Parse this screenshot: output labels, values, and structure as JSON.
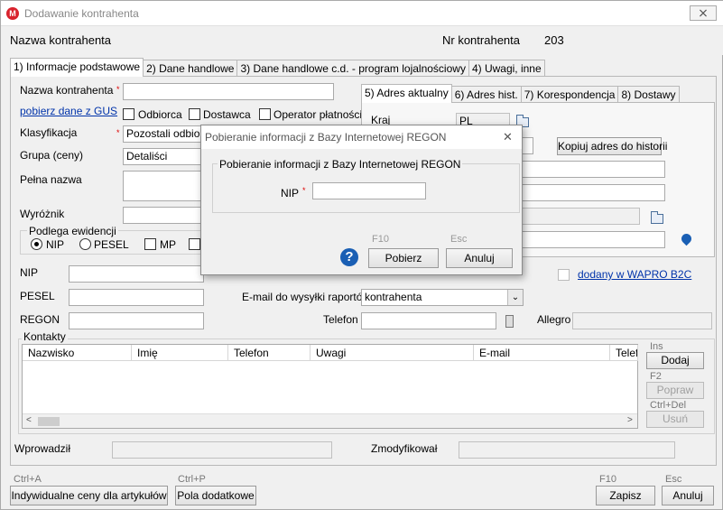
{
  "window": {
    "title": "Dodawanie kontrahenta",
    "close": "⨯"
  },
  "header": {
    "name_label": "Nazwa kontrahenta",
    "nr_label": "Nr kontrahenta",
    "nr_value": "203"
  },
  "tabs": [
    {
      "label": "1) Informacje podstawowe"
    },
    {
      "label": "2) Dane handlowe"
    },
    {
      "label": "3) Dane handlowe c.d. - program lojalnościowy"
    },
    {
      "label": "4) Uwagi, inne"
    }
  ],
  "form": {
    "nazwa_label": "Nazwa kontrahenta",
    "nazwa_value": "",
    "gus_link": "pobierz dane z GUS",
    "odbiorca": "Odbiorca",
    "dostawca": "Dostawca",
    "operator": "Operator płatności",
    "klasyfikacja_label": "Klasyfikacja",
    "klasyfikacja_value": "Pozostali odbiorcy",
    "grupa_label": "Grupa (ceny)",
    "grupa_value": "Detaliści",
    "pelna_label": "Pełna nazwa",
    "wyroznik_label": "Wyróżnik",
    "ewidencja_label": "Podlega ewidencji",
    "radio_nip": "NIP",
    "radio_pesel": "PESEL",
    "chk_mp": "MP",
    "nip_label": "NIP",
    "pesel_label": "PESEL",
    "regon_label": "REGON",
    "email_raport_label": "E-mail do wysyłki raportów",
    "email_raport_value": "kontrahenta",
    "telefon_label": "Telefon",
    "allegro_label": "Allegro",
    "wapro_link": "dodany w WAPRO B2C",
    "kontakty_label": "Kontakty",
    "wprowadzil_label": "Wprowadził",
    "zmodyfikowal_label": "Zmodyfikował"
  },
  "address_tabs": [
    {
      "label": "5) Adres aktualny"
    },
    {
      "label": "6) Adres hist."
    },
    {
      "label": "7) Korespondencja"
    },
    {
      "label": "8) Dostawy"
    }
  ],
  "address": {
    "kraj_label": "Kraj",
    "kraj_value": "PL",
    "kopiuj_button": "Kopiuj adres do historii"
  },
  "kontakty": {
    "columns": [
      "Nazwisko",
      "Imię",
      "Telefon",
      "Uwagi",
      "E-mail",
      "Telef"
    ],
    "hint_ins": "Ins",
    "btn_dodaj": "Dodaj",
    "hint_f2": "F2",
    "btn_popraw": "Popraw",
    "hint_ctrldel": "Ctrl+Del",
    "btn_usun": "Usuń"
  },
  "footer": {
    "hint_ctrla": "Ctrl+A",
    "btn_ceny": "Indywidualne ceny dla artykułów",
    "hint_ctrlp": "Ctrl+P",
    "btn_pola": "Pola dodatkowe",
    "hint_f10": "F10",
    "btn_zapisz": "Zapisz",
    "hint_esc": "Esc",
    "btn_anuluj": "Anuluj"
  },
  "dialog": {
    "title": "Pobieranie informacji z Bazy Internetowej REGON",
    "close": "✕",
    "group_label": "Pobieranie informacji z Bazy Internetowej REGON",
    "nip_label": "NIP",
    "nip_value": "",
    "hint_f10": "F10",
    "hint_esc": "Esc",
    "btn_pobierz": "Pobierz",
    "btn_anuluj": "Anuluj",
    "help": "?"
  },
  "colors": {
    "accent_link": "#0033aa",
    "required": "#dd0000",
    "help_blue": "#1a5fb4",
    "logo_red": "#d9232d"
  }
}
